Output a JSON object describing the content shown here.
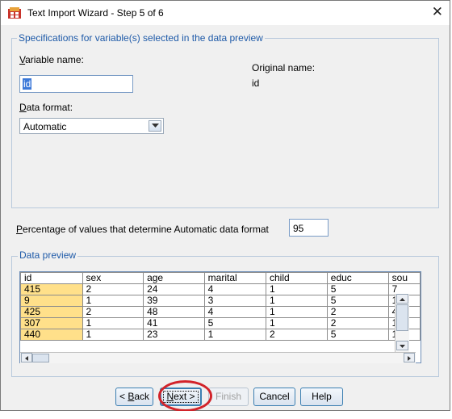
{
  "window": {
    "title": "Text Import Wizard - Step 5 of 6",
    "close_glyph": "✕"
  },
  "spec": {
    "group_label": "Specifications for variable(s) selected in the data preview",
    "varname_label_u": "V",
    "varname_label_rest": "ariable name:",
    "varname_value": "id",
    "original_label": "Original name:",
    "original_value": "id",
    "format_label_u": "D",
    "format_label_rest": "ata format:",
    "format_value": "Automatic"
  },
  "percentage": {
    "label_u": "P",
    "label_rest": "ercentage of values that determine Automatic data format",
    "value": "95"
  },
  "preview": {
    "group_label": "Data preview",
    "columns": [
      "id",
      "sex",
      "age",
      "marital",
      "child",
      "educ",
      "sou"
    ],
    "rows": [
      [
        "415",
        "2",
        "24",
        "4",
        "1",
        "5",
        "7"
      ],
      [
        "9",
        "1",
        "39",
        "3",
        "1",
        "5",
        "1"
      ],
      [
        "425",
        "2",
        "48",
        "4",
        "1",
        "2",
        "4"
      ],
      [
        "307",
        "1",
        "41",
        "5",
        "1",
        "2",
        "1"
      ],
      [
        "440",
        "1",
        "23",
        "1",
        "2",
        "5",
        "1"
      ]
    ]
  },
  "buttons": {
    "back_u": "B",
    "back_pre": "< ",
    "back_rest": "ack",
    "next_u": "N",
    "next_rest": "ext >",
    "finish": "Finish",
    "cancel": "Cancel",
    "help": "Help"
  },
  "colors": {
    "accent_blue": "#1e5aa8",
    "id_column_highlight": "#ffe08a",
    "annotation_red": "#d2232a"
  }
}
